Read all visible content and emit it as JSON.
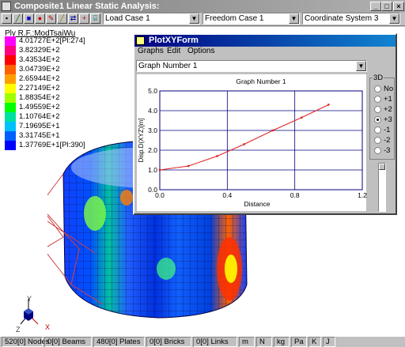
{
  "window": {
    "title": "Composite1 Linear Static Analysis:"
  },
  "toolbar": {
    "load_case": "Load Case 1",
    "freedom_case": "Freedom Case 1",
    "coord_system": "Coordinate System 3"
  },
  "legend": {
    "title": "Ply R.F.:ModTsaiWu",
    "entries": [
      {
        "label": "4.01727E+2[Pl:274]",
        "color": "#ff00ff"
      },
      {
        "label": "3.82329E+2",
        "color": "#ff0080"
      },
      {
        "label": "3.43534E+2",
        "color": "#ff0000"
      },
      {
        "label": "3.04739E+2",
        "color": "#ff6000"
      },
      {
        "label": "2.65944E+2",
        "color": "#ffa000"
      },
      {
        "label": "2.27149E+2",
        "color": "#ffff00"
      },
      {
        "label": "1.88354E+2",
        "color": "#a0ff00"
      },
      {
        "label": "1.49559E+2",
        "color": "#00ff00"
      },
      {
        "label": "1.10764E+2",
        "color": "#00e0a0"
      },
      {
        "label": "7.19695E+1",
        "color": "#00c0ff"
      },
      {
        "label": "3.31745E+1",
        "color": "#0060ff"
      },
      {
        "label": "1.37769E+1[Pl:390]",
        "color": "#0000ff"
      }
    ]
  },
  "plot_form": {
    "title": "PlotXYForm",
    "menu": [
      "Graphs",
      "Edit",
      "Options"
    ],
    "graph_select": "Graph Number 1",
    "options_3d": {
      "label": "3D",
      "items": [
        "No",
        "+1",
        "+2",
        "+3",
        "-1",
        "-2",
        "-3"
      ],
      "selected": "+3"
    }
  },
  "chart_data": {
    "type": "line",
    "title": "Graph Number 1",
    "xlabel": "Distance",
    "ylabel": "Disp.D(XYZ)[m]",
    "xlim": [
      0.0,
      1.2
    ],
    "ylim": [
      0.0,
      5.0
    ],
    "xticks": [
      "0.0",
      "0.4",
      "0.8",
      "1.2"
    ],
    "yticks": [
      "0.0",
      "1.0",
      "2.0",
      "3.0",
      "4.0",
      "5.0"
    ],
    "grid": true,
    "series": [
      {
        "color": "#e02020",
        "x": [
          0.0,
          0.17,
          0.34,
          0.5,
          0.67,
          0.84,
          1.0
        ],
        "y": [
          1.0,
          1.2,
          1.7,
          2.3,
          3.0,
          3.65,
          4.3
        ]
      }
    ]
  },
  "axes_triad": {
    "y": "Y",
    "x": "X",
    "z": "Z"
  },
  "status": [
    "520[0] Nodes",
    "0[0] Beams",
    "480[0] Plates",
    "0[0] Bricks",
    "0[0] Links",
    "m",
    "N",
    "kg",
    "Pa",
    "K",
    "J"
  ]
}
